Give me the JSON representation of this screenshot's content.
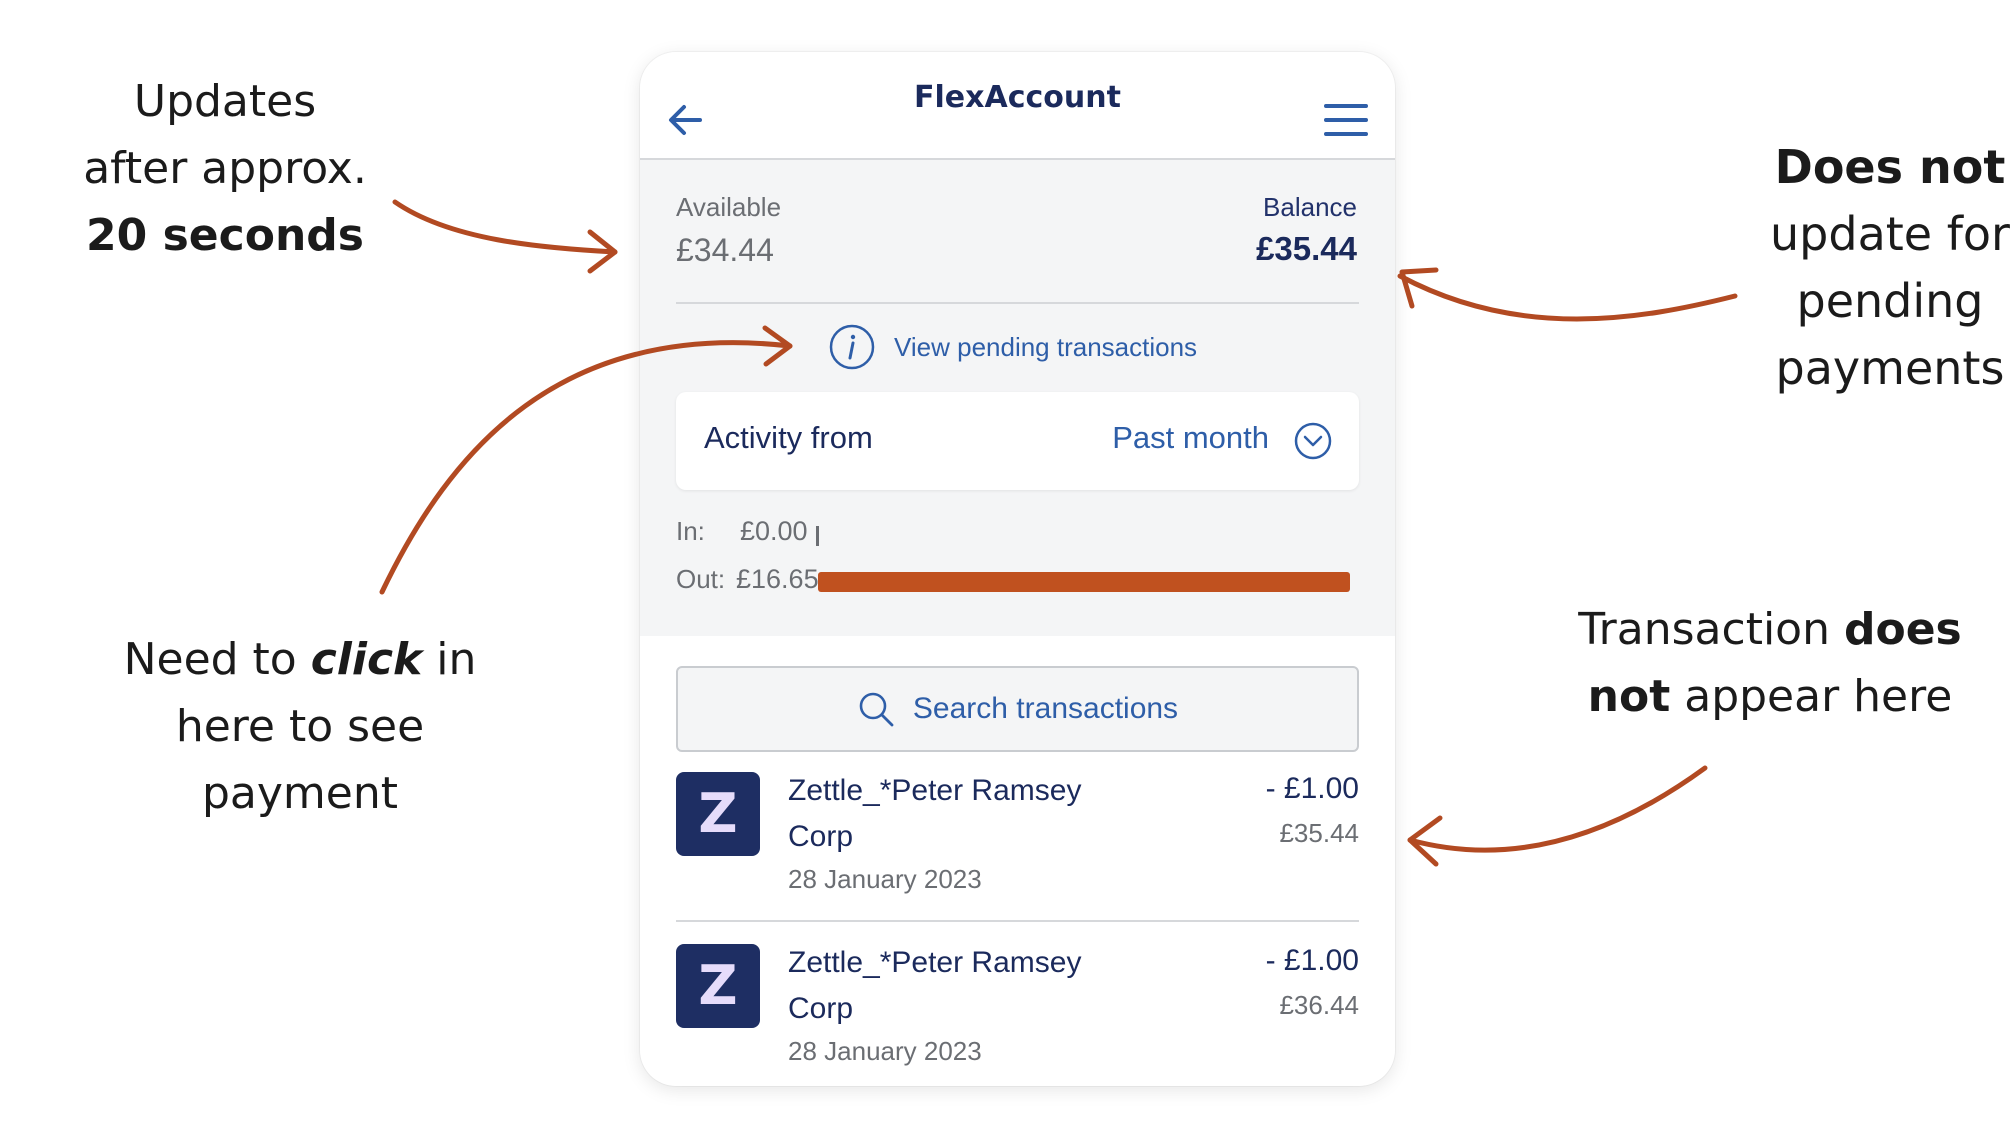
{
  "annotations": {
    "top_left": {
      "line1": "Updates",
      "line2": "after approx.",
      "line3_bold": "20 seconds"
    },
    "top_right": {
      "line1_bold": "Does not",
      "line2": "update for",
      "line3": "pending",
      "line4": "payments"
    },
    "mid_left": {
      "part1": "Need to ",
      "part2_bold_italic": "click",
      "part3": " in",
      "line2": "here to see",
      "line3": "payment"
    },
    "mid_right": {
      "part1": "Transaction ",
      "part2_bold": "does",
      "part3_bold": "not",
      "part4": " appear here"
    }
  },
  "colors": {
    "arrow": "#b24a22",
    "navy": "#1b2a5c",
    "link_blue": "#2e5ea8",
    "bar_fill": "#c0511f"
  },
  "app": {
    "title": "FlexAccount",
    "back_icon": "arrow-left-icon",
    "menu_icon": "hamburger-menu-icon",
    "available_label": "Available",
    "available_value": "£34.44",
    "balance_label": "Balance",
    "balance_value": "£35.44",
    "pending_link": "View pending transactions",
    "activity_label": "Activity from",
    "activity_value": "Past month",
    "in_label": "In:",
    "in_value": "£0.00",
    "out_label": "Out:",
    "out_value": "£16.65",
    "out_bar_fraction": 1.0,
    "search_placeholder": "Search transactions",
    "transactions": [
      {
        "logo_letter": "Z",
        "name": "Zettle_*Peter Ramsey Corp",
        "date": "28 January 2023",
        "amount": "- £1.00",
        "balance": "£35.44"
      },
      {
        "logo_letter": "Z",
        "name": "Zettle_*Peter Ramsey Corp",
        "date": "28 January 2023",
        "amount": "- £1.00",
        "balance": "£36.44"
      }
    ]
  }
}
